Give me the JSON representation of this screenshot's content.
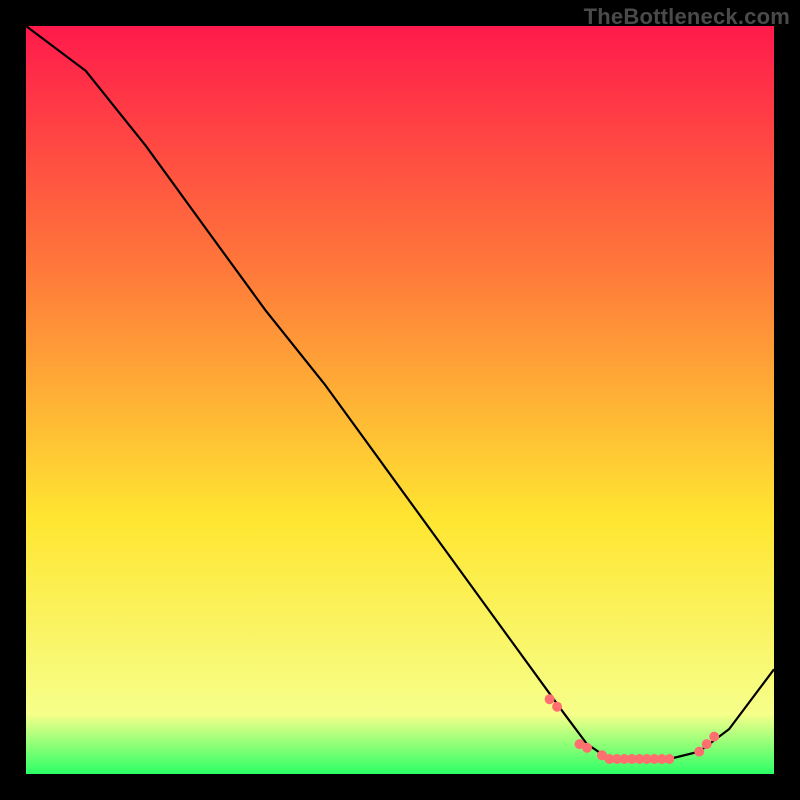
{
  "watermark": "TheBottleneck.com",
  "chart_data": {
    "type": "line",
    "title": "",
    "xlabel": "",
    "ylabel": "",
    "xlim": [
      0,
      100
    ],
    "ylim": [
      0,
      100
    ],
    "grid": false,
    "legend": false,
    "background_gradient": {
      "top_color": "#ff1a4b",
      "mid_upper_color": "#ff7a3a",
      "mid_lower_color": "#ffe631",
      "near_bottom_color": "#f6ff8a",
      "bottom_color": "#2cff66"
    },
    "series": [
      {
        "name": "bottleneck-curve",
        "color": "#000000",
        "x": [
          0,
          8,
          16,
          24,
          32,
          40,
          48,
          56,
          64,
          72,
          75,
          78,
          82,
          86,
          90,
          94,
          100
        ],
        "y": [
          100,
          94,
          84,
          73,
          62,
          52,
          41,
          30,
          19,
          8,
          4,
          2,
          2,
          2,
          3,
          6,
          14
        ]
      }
    ],
    "markers": {
      "name": "highlight-points",
      "color": "#ff6f6f",
      "radius": 5,
      "x": [
        70,
        71,
        74,
        75,
        77,
        78,
        79,
        80,
        81,
        82,
        83,
        84,
        85,
        86,
        90,
        91,
        92
      ],
      "y": [
        10,
        9,
        4,
        3.5,
        2.5,
        2,
        2,
        2,
        2,
        2,
        2,
        2,
        2,
        2,
        3,
        4,
        5
      ]
    }
  }
}
